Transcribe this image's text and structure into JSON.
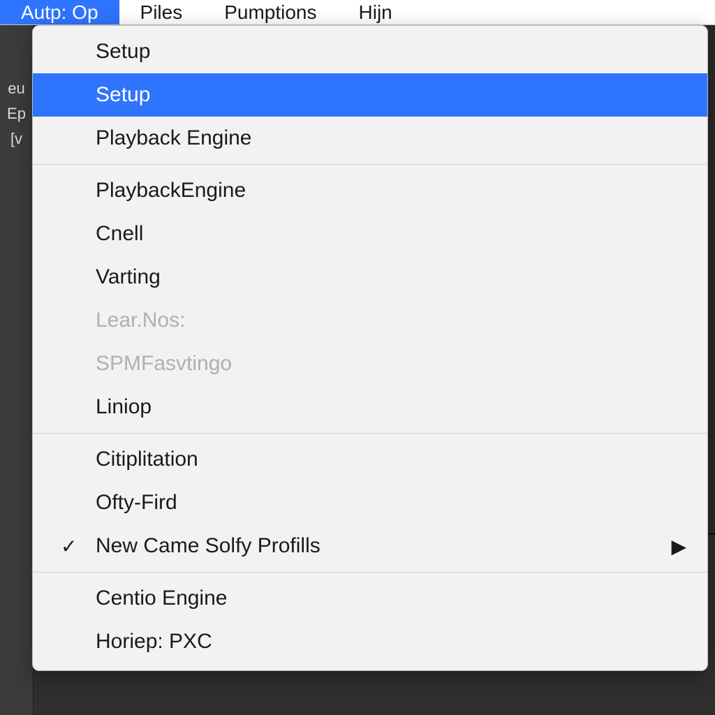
{
  "menubar": {
    "items": [
      {
        "label": "Autp: Op",
        "active": true
      },
      {
        "label": "Piles",
        "active": false
      },
      {
        "label": "Pumptions",
        "active": false
      },
      {
        "label": "Hijn",
        "active": false
      }
    ]
  },
  "side_fragments": [
    "eu",
    "Ep",
    "[v"
  ],
  "dropdown": {
    "groups": [
      [
        {
          "label": "Setup",
          "highlight": false,
          "disabled": false,
          "checked": false,
          "submenu": false
        },
        {
          "label": "Setup",
          "highlight": true,
          "disabled": false,
          "checked": false,
          "submenu": false
        },
        {
          "label": "Playback Engine",
          "highlight": false,
          "disabled": false,
          "checked": false,
          "submenu": false
        }
      ],
      [
        {
          "label": "PlaybackEngine",
          "highlight": false,
          "disabled": false,
          "checked": false,
          "submenu": false
        },
        {
          "label": "Cnell",
          "highlight": false,
          "disabled": false,
          "checked": false,
          "submenu": false
        },
        {
          "label": "Varting",
          "highlight": false,
          "disabled": false,
          "checked": false,
          "submenu": false
        },
        {
          "label": "Lear.Nos:",
          "highlight": false,
          "disabled": true,
          "checked": false,
          "submenu": false
        },
        {
          "label": "SPMFasvtingo",
          "highlight": false,
          "disabled": true,
          "checked": false,
          "submenu": false
        },
        {
          "label": "Liniop",
          "highlight": false,
          "disabled": false,
          "checked": false,
          "submenu": false
        }
      ],
      [
        {
          "label": "Citiplitation",
          "highlight": false,
          "disabled": false,
          "checked": false,
          "submenu": false
        },
        {
          "label": "Ofty-Fird",
          "highlight": false,
          "disabled": false,
          "checked": false,
          "submenu": false
        },
        {
          "label": "New Came Solfy Profills",
          "highlight": false,
          "disabled": false,
          "checked": true,
          "submenu": true
        }
      ],
      [
        {
          "label": "Centio Engine",
          "highlight": false,
          "disabled": false,
          "checked": false,
          "submenu": false
        },
        {
          "label": "Horiep: PXC",
          "highlight": false,
          "disabled": false,
          "checked": false,
          "submenu": false
        }
      ]
    ]
  },
  "glyphs": {
    "check": "✓",
    "arrow": "▶"
  }
}
